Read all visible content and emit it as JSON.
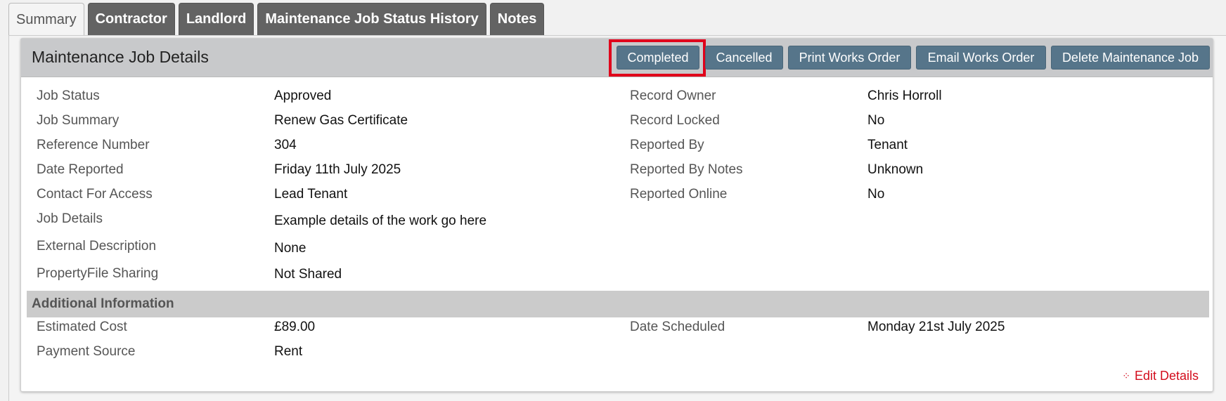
{
  "tabs": [
    {
      "label": "Summary",
      "active": true
    },
    {
      "label": "Contractor",
      "active": false
    },
    {
      "label": "Landlord",
      "active": false
    },
    {
      "label": "Maintenance Job Status History",
      "active": false
    },
    {
      "label": "Notes",
      "active": false
    }
  ],
  "card": {
    "title": "Maintenance Job Details",
    "buttons": {
      "completed": "Completed",
      "cancelled": "Cancelled",
      "print_works_order": "Print Works Order",
      "email_works_order": "Email Works Order",
      "delete_job": "Delete Maintenance Job"
    }
  },
  "details_left": [
    {
      "label": "Job Status",
      "value": "Approved"
    },
    {
      "label": "Job Summary",
      "value": "Renew Gas Certificate"
    },
    {
      "label": "Reference Number",
      "value": "304"
    },
    {
      "label": "Date Reported",
      "value": "Friday 11th July 2025"
    },
    {
      "label": "Contact For Access",
      "value": "Lead Tenant"
    },
    {
      "label": "Job Details",
      "value": "Example details of the work go here"
    },
    {
      "label": "External Description",
      "value": "None"
    },
    {
      "label": "PropertyFile Sharing",
      "value": "Not Shared"
    }
  ],
  "details_right": [
    {
      "label": "Record Owner",
      "value": "Chris Horroll"
    },
    {
      "label": "Record Locked",
      "value": "No"
    },
    {
      "label": "Reported By",
      "value": "Tenant"
    },
    {
      "label": "Reported By Notes",
      "value": "Unknown"
    },
    {
      "label": "Reported Online",
      "value": "No"
    }
  ],
  "additional": {
    "heading": "Additional Information",
    "left": [
      {
        "label": "Estimated Cost",
        "value": "£89.00"
      },
      {
        "label": "Payment Source",
        "value": "Rent"
      }
    ],
    "right": [
      {
        "label": "Date Scheduled",
        "value": "Monday 21st July 2025"
      }
    ]
  },
  "edit_link": {
    "icon": "edit-icon",
    "label": "Edit Details"
  },
  "colors": {
    "button": "#56758a",
    "highlight": "#e0001b",
    "link": "#d30c1c"
  }
}
